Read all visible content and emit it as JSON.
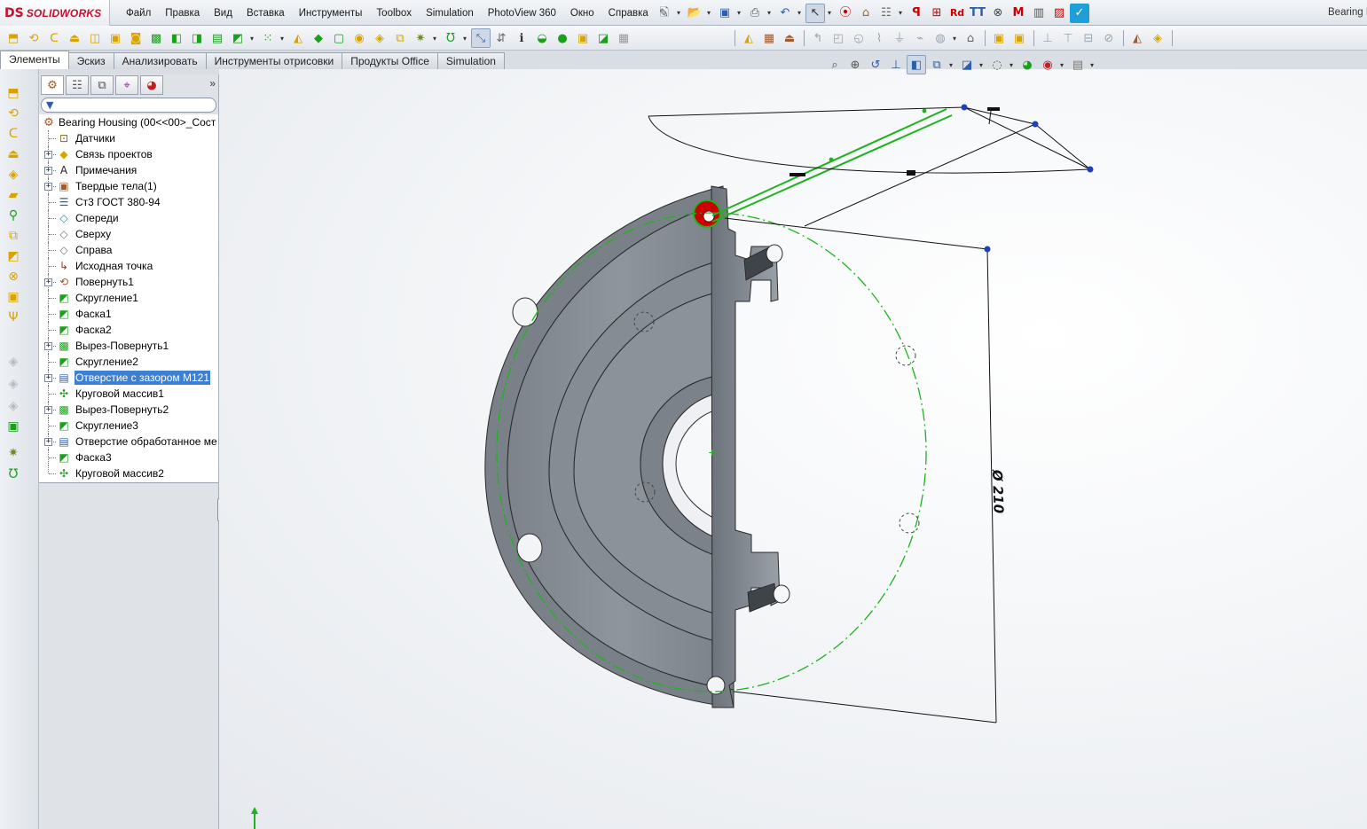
{
  "app": {
    "brand_mark": "DS",
    "brand_name": "SOLIDWORKS",
    "document_title": "Bearing Housing"
  },
  "menus": [
    "Файл",
    "Правка",
    "Вид",
    "Вставка",
    "Инструменты",
    "Toolbox",
    "Simulation",
    "PhotoView 360",
    "Окно",
    "Справка"
  ],
  "tabs": [
    {
      "label": "Элементы",
      "active": true
    },
    {
      "label": "Эскиз",
      "active": false
    },
    {
      "label": "Анализировать",
      "active": false
    },
    {
      "label": "Инструменты отрисовки",
      "active": false
    },
    {
      "label": "Продукты Office",
      "active": false
    },
    {
      "label": "Simulation",
      "active": false
    }
  ],
  "tree": {
    "filter_icon": "filter-icon",
    "root_label": "Bearing Housing  (00<<00>_Сост",
    "items": [
      {
        "label": "Датчики",
        "icon": "sensor-icon",
        "glyph": "⊡",
        "expandable": false,
        "selected": false
      },
      {
        "label": "Связь проектов",
        "icon": "design-binder-icon",
        "glyph": "◆",
        "expandable": true,
        "selected": false
      },
      {
        "label": "Примечания",
        "icon": "annotations-icon",
        "glyph": "A",
        "expandable": true,
        "selected": false
      },
      {
        "label": "Твердые тела(1)",
        "icon": "solid-bodies-icon",
        "glyph": "▣",
        "expandable": true,
        "selected": false
      },
      {
        "label": "Ст3 ГОСТ 380-94",
        "icon": "material-icon",
        "glyph": "☰",
        "expandable": false,
        "selected": false
      },
      {
        "label": "Спереди",
        "icon": "front-plane-icon",
        "glyph": "◇",
        "expandable": false,
        "selected": false
      },
      {
        "label": "Сверху",
        "icon": "top-plane-icon",
        "glyph": "◇",
        "expandable": false,
        "selected": false
      },
      {
        "label": "Справа",
        "icon": "right-plane-icon",
        "glyph": "◇",
        "expandable": false,
        "selected": false
      },
      {
        "label": "Исходная точка",
        "icon": "origin-icon",
        "glyph": "↳",
        "expandable": false,
        "selected": false
      },
      {
        "label": "Повернуть1",
        "icon": "revolve-icon",
        "glyph": "⟲",
        "expandable": true,
        "selected": false
      },
      {
        "label": "Скругление1",
        "icon": "fillet-icon",
        "glyph": "◩",
        "expandable": false,
        "selected": false
      },
      {
        "label": "Фаска1",
        "icon": "chamfer-icon",
        "glyph": "◩",
        "expandable": false,
        "selected": false
      },
      {
        "label": "Фаска2",
        "icon": "chamfer-icon",
        "glyph": "◩",
        "expandable": false,
        "selected": false
      },
      {
        "label": "Вырез-Повернуть1",
        "icon": "revolved-cut-icon",
        "glyph": "▩",
        "expandable": true,
        "selected": false
      },
      {
        "label": "Скругление2",
        "icon": "fillet-icon",
        "glyph": "◩",
        "expandable": false,
        "selected": false
      },
      {
        "label": "Отверстие с зазором M121",
        "icon": "hole-wizard-icon",
        "glyph": "▤",
        "expandable": true,
        "selected": true
      },
      {
        "label": "Круговой массив1",
        "icon": "circular-pattern-icon",
        "glyph": "✣",
        "expandable": false,
        "selected": false
      },
      {
        "label": "Вырез-Повернуть2",
        "icon": "revolved-cut-icon",
        "glyph": "▩",
        "expandable": true,
        "selected": false
      },
      {
        "label": "Скругление3",
        "icon": "fillet-icon",
        "glyph": "◩",
        "expandable": false,
        "selected": false
      },
      {
        "label": "Отверстие обработанное ме",
        "icon": "hole-wizard-icon",
        "glyph": "▤",
        "expandable": true,
        "selected": false
      },
      {
        "label": "Фаска3",
        "icon": "chamfer-icon",
        "glyph": "◩",
        "expandable": false,
        "selected": false
      },
      {
        "label": "Круговой массив2",
        "icon": "circular-pattern-icon",
        "glyph": "✣",
        "expandable": false,
        "selected": false
      }
    ]
  },
  "model": {
    "dimension_text": "Ø 210",
    "part_color": "#8d939b",
    "sketch_color": "#1db31d",
    "selection_color": "#cc0000"
  }
}
